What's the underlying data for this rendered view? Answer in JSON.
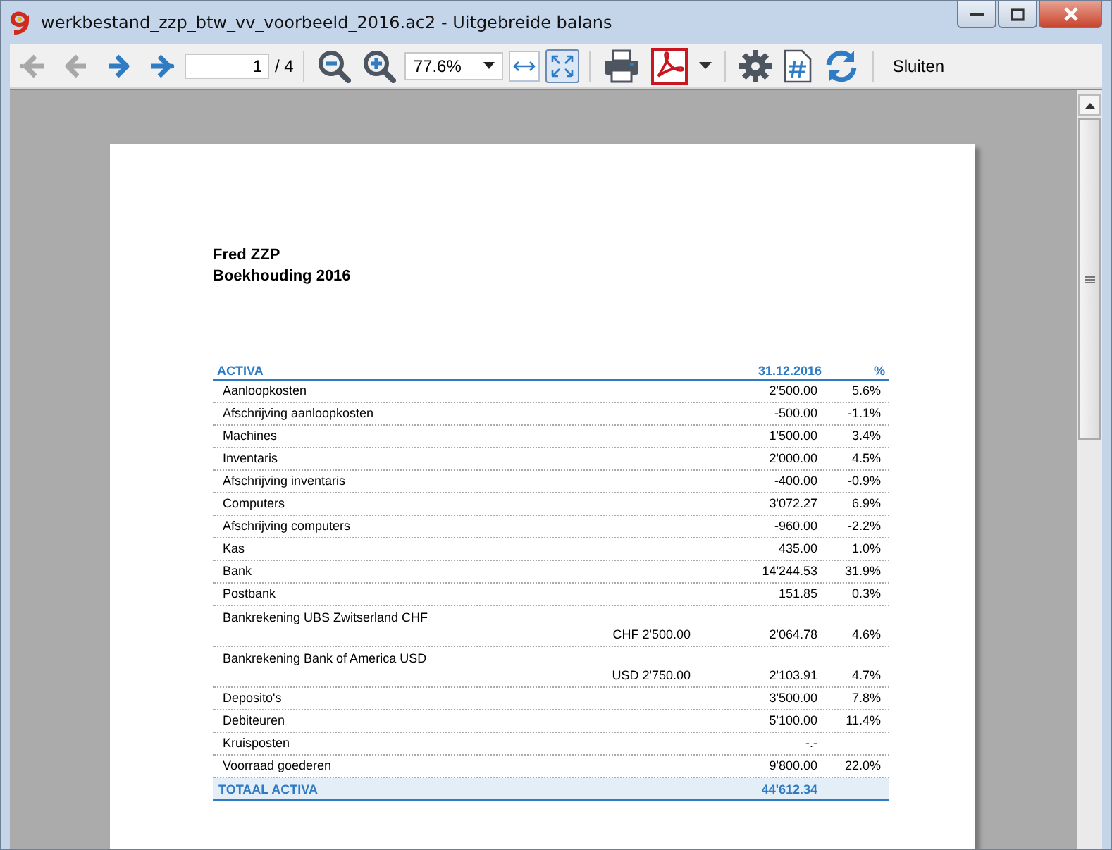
{
  "window": {
    "title": "werkbestand_zzp_btw_vv_voorbeeld_2016.ac2 - Uitgebreide balans"
  },
  "toolbar": {
    "buttons": [
      {
        "kind": "first",
        "disabled": true
      },
      {
        "kind": "prev",
        "disabled": true
      },
      {
        "kind": "next",
        "disabled": false
      },
      {
        "kind": "last",
        "disabled": false
      }
    ],
    "page_field": {
      "value": "1"
    },
    "page_count": "/ 4",
    "zoom_buttons": [
      {
        "kind": "zoom_out"
      },
      {
        "kind": "zoom_in"
      }
    ],
    "zoom_select": {
      "value": "77.6%"
    },
    "fit_buttons": [
      {
        "kind": "fit_width",
        "selected": false
      },
      {
        "kind": "fit_page",
        "selected": true
      }
    ],
    "tools": [
      {
        "kind": "print"
      },
      {
        "kind": "pdf"
      },
      {
        "kind": "caret"
      },
      {
        "kind": "settings"
      },
      {
        "kind": "numbering"
      },
      {
        "kind": "refresh"
      }
    ],
    "close_label": "Sluiten"
  },
  "report": {
    "company": "Fred ZZP",
    "subtitle": "Boekhouding 2016",
    "columns": [
      "ACTIVA",
      "31.12.2016",
      "%"
    ],
    "rows": [
      {
        "label": "Aanloopkosten",
        "amount": "2'500.00",
        "percent": "5.6%"
      },
      {
        "label": "Afschrijving aanloopkosten",
        "amount": "-500.00",
        "percent": "-1.1%"
      },
      {
        "label": "Machines",
        "amount": "1'500.00",
        "percent": "3.4%"
      },
      {
        "label": "Inventaris",
        "amount": "2'000.00",
        "percent": "4.5%"
      },
      {
        "label": "Afschrijving inventaris",
        "amount": "-400.00",
        "percent": "-0.9%"
      },
      {
        "label": "Computers",
        "amount": "3'072.27",
        "percent": "6.9%"
      },
      {
        "label": "Afschrijving computers",
        "amount": "-960.00",
        "percent": "-2.2%"
      },
      {
        "label": "Kas",
        "amount": "435.00",
        "percent": "1.0%"
      },
      {
        "label": "Bank",
        "amount": "14'244.53",
        "percent": "31.9%"
      },
      {
        "label": "Postbank",
        "amount": "151.85",
        "percent": "0.3%"
      },
      {
        "label": "Bankrekening UBS Zwitserland CHF",
        "foreign": "CHF 2'500.00",
        "amount": "2'064.78",
        "percent": "4.6%"
      },
      {
        "label": "Bankrekening Bank of America USD",
        "foreign": "USD 2'750.00",
        "amount": "2'103.91",
        "percent": "4.7%"
      },
      {
        "label": "Deposito's",
        "amount": "3'500.00",
        "percent": "7.8%"
      },
      {
        "label": "Debiteuren",
        "amount": "5'100.00",
        "percent": "11.4%"
      },
      {
        "label": "Kruisposten",
        "amount": "-.-"
      },
      {
        "label": "Voorraad goederen",
        "amount": "9'800.00",
        "percent": "22.0%"
      }
    ],
    "total": {
      "label": "TOTAAL ACTIVA",
      "amount": "44'612.34"
    }
  }
}
